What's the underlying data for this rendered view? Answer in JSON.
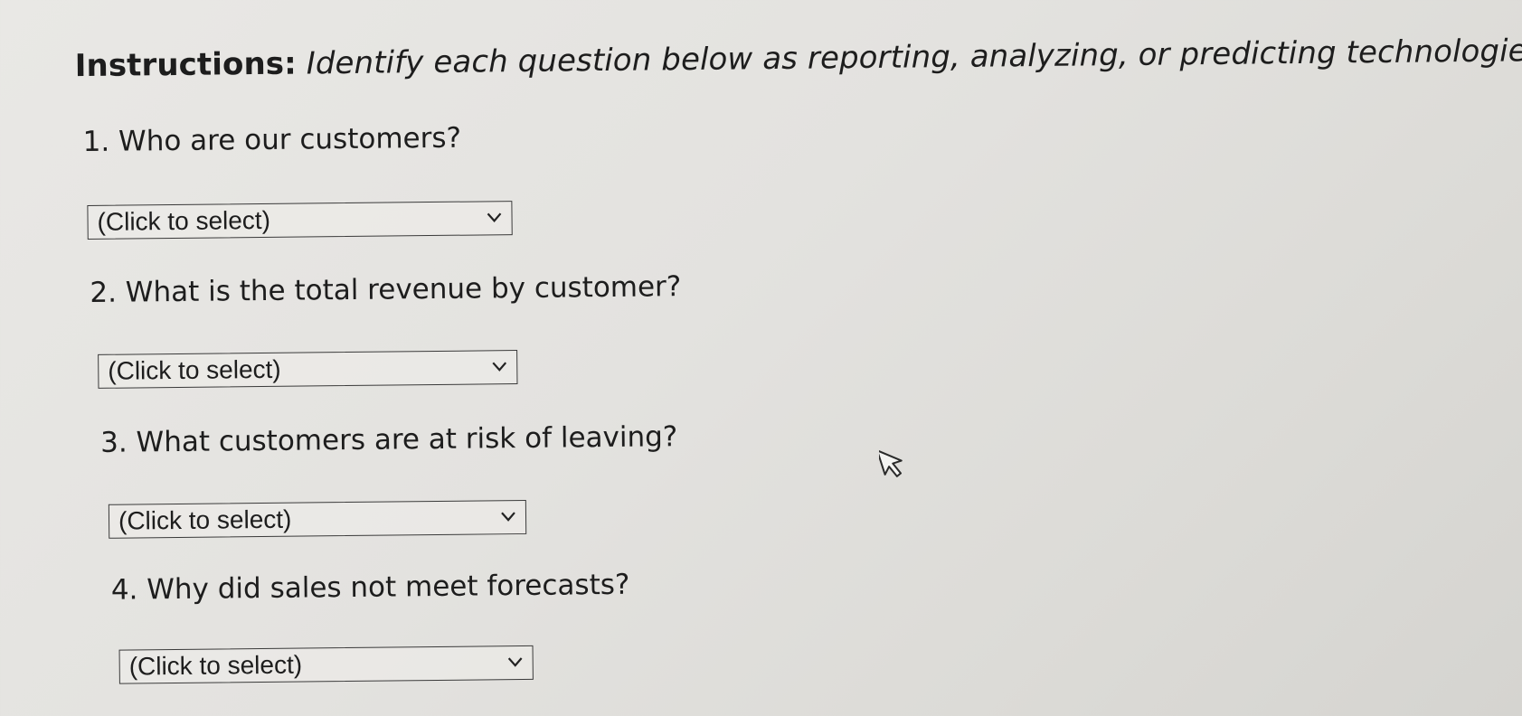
{
  "instructions": {
    "lead": "Instructions:",
    "body": " Identify each question below as reporting, analyzing, or predicting technologies."
  },
  "questions": [
    {
      "text": "1. Who are our customers?",
      "selected": "(Click to select)"
    },
    {
      "text": "2. What is the total revenue by customer?",
      "selected": "(Click to select)"
    },
    {
      "text": "3. What customers are at risk of leaving?",
      "selected": "(Click to select)"
    },
    {
      "text": "4. Why did sales not meet forecasts?",
      "selected": "(Click to select)"
    }
  ],
  "icons": {
    "dropdown": "chevron-down-icon",
    "pointer": "mouse-pointer-icon"
  }
}
